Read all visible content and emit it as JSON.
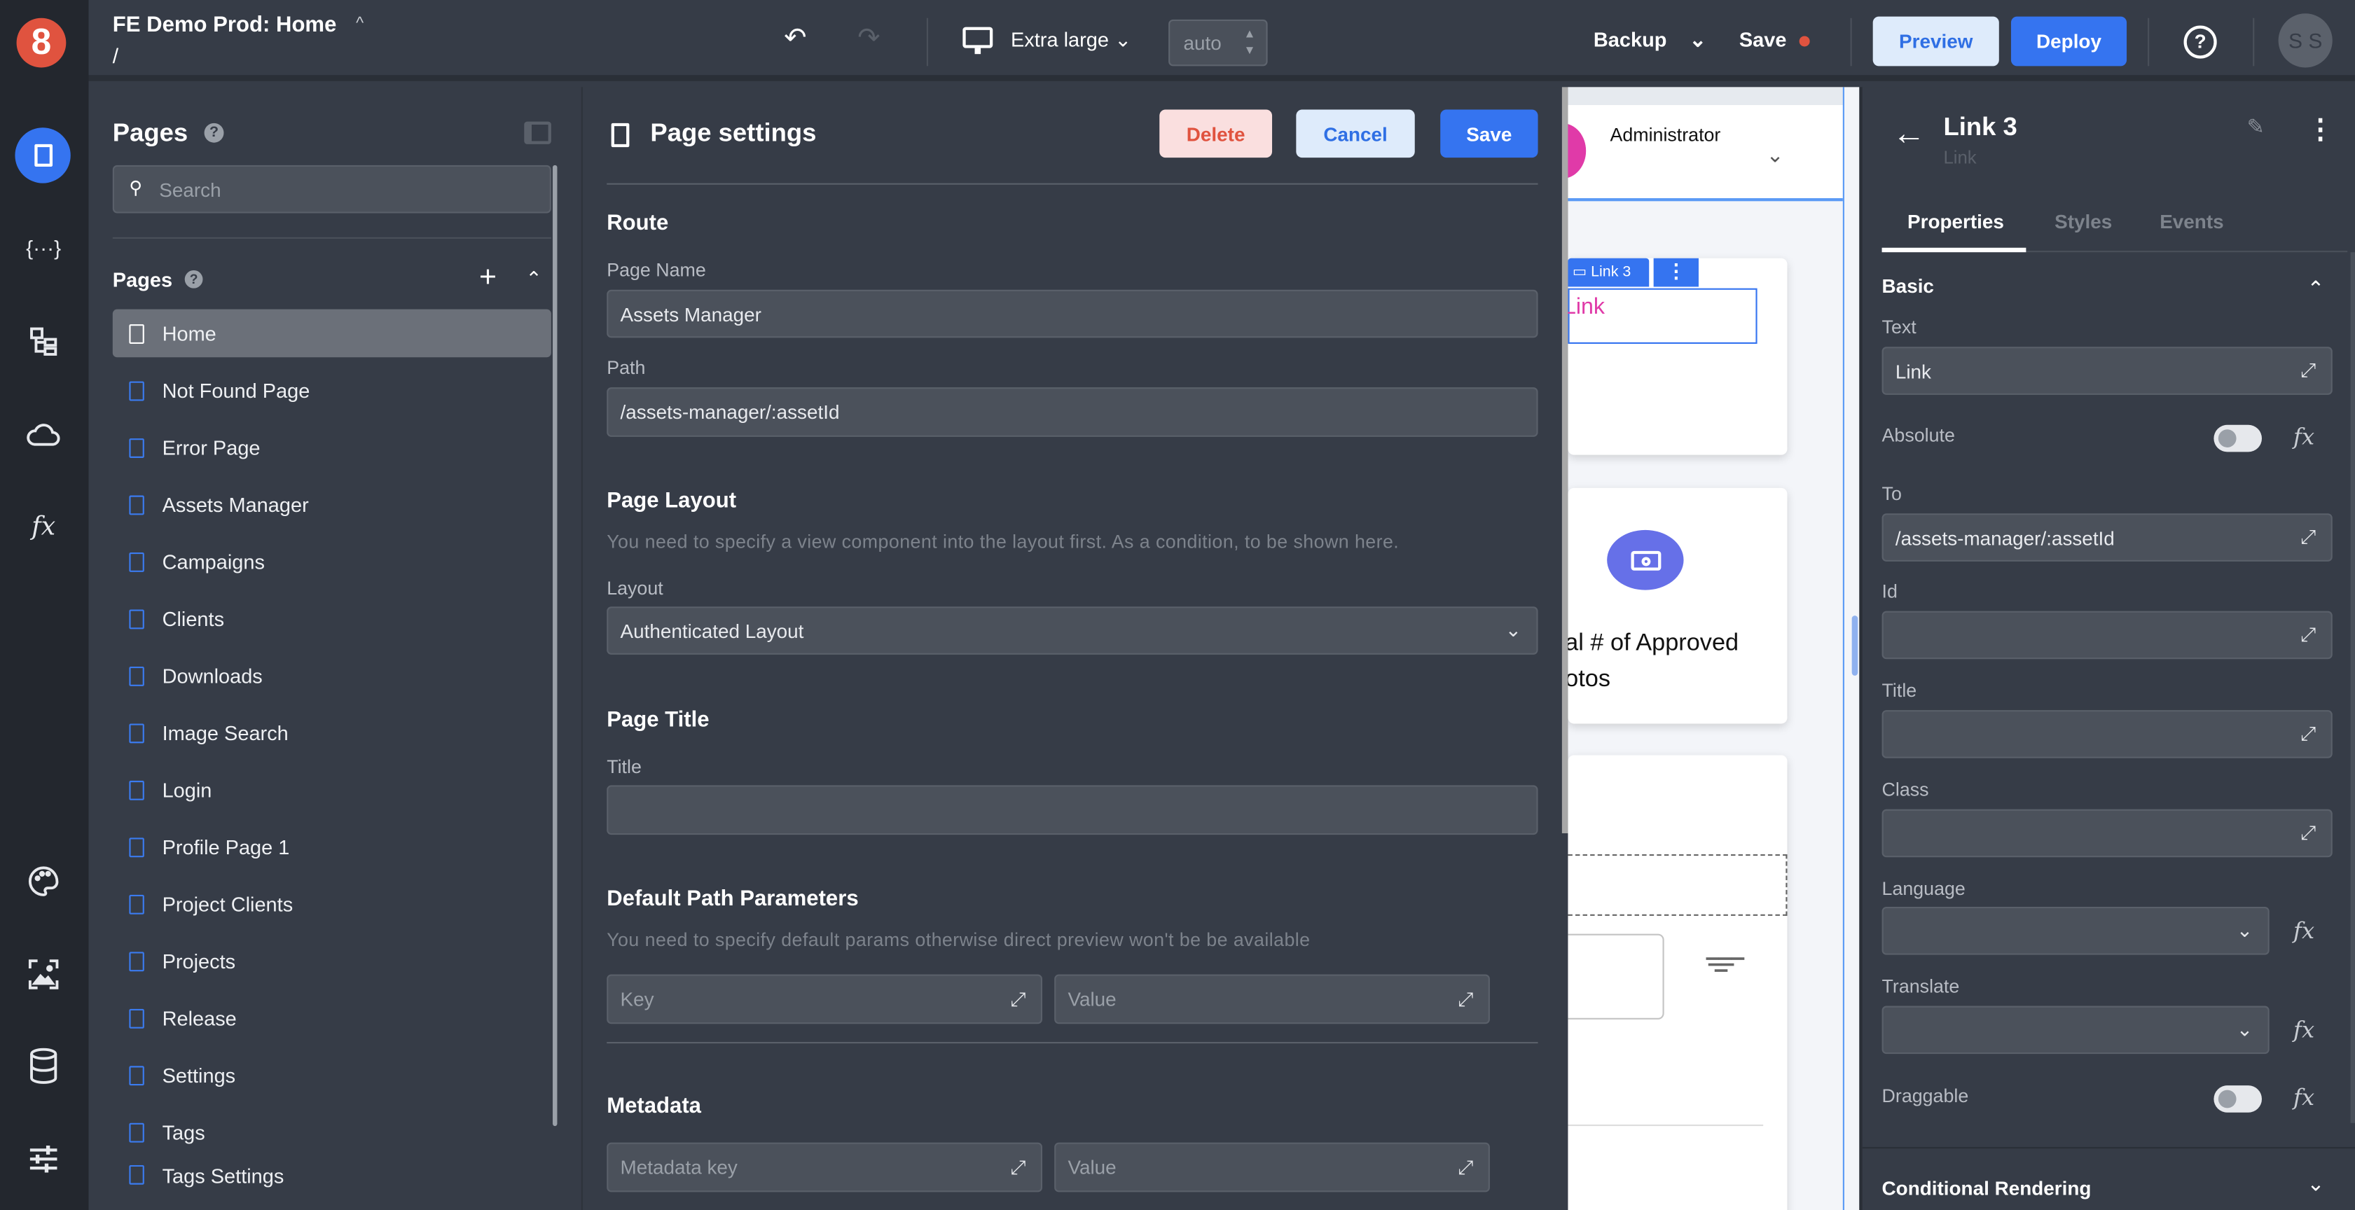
{
  "rail": {
    "logo": "8",
    "top_icons": [
      "pages-icon",
      "variables-icon",
      "components-tree-icon",
      "cloud-icon",
      "functions-icon"
    ],
    "bottom_icons": [
      "palette-icon",
      "media-icon",
      "database-icon",
      "settings-sliders-icon"
    ]
  },
  "topbar": {
    "title": "FE Demo Prod: Home",
    "route": "/",
    "device": "Extra large",
    "zoom": "auto",
    "backup": "Backup",
    "save": "Save",
    "preview": "Preview",
    "deploy": "Deploy",
    "avatar": "S S"
  },
  "pages_panel": {
    "title": "Pages",
    "search_placeholder": "Search",
    "section": "Pages",
    "items": [
      "Home",
      "Not Found Page",
      "Error Page",
      "Assets Manager",
      "Campaigns",
      "Clients",
      "Downloads",
      "Image Search",
      "Login",
      "Profile Page 1",
      "Project Clients",
      "Projects",
      "Release",
      "Settings",
      "Tags",
      "Tags Settings"
    ],
    "selected": "Home"
  },
  "page_settings": {
    "title": "Page settings",
    "delete": "Delete",
    "cancel": "Cancel",
    "save": "Save",
    "route": {
      "heading": "Route",
      "page_name_label": "Page Name",
      "page_name": "Assets Manager",
      "path_label": "Path",
      "path": "/assets-manager/:assetId"
    },
    "layout": {
      "heading": "Page Layout",
      "hint": "You need to specify a view component into the layout first. As a condition, to be shown here.",
      "label": "Layout",
      "value": "Authenticated Layout"
    },
    "page_title": {
      "heading": "Page Title",
      "label": "Title",
      "value": ""
    },
    "params": {
      "heading": "Default Path Parameters",
      "hint": "You need to specify default params otherwise direct preview won't be be available",
      "key_placeholder": "Key",
      "value_placeholder": "Value"
    },
    "metadata": {
      "heading": "Metadata",
      "key_placeholder": "Metadata key",
      "value_placeholder": "Value"
    }
  },
  "canvas": {
    "user": "Administrator",
    "badge": "Link 3",
    "link_text": "Link",
    "stat_line1": "al # of Approved",
    "stat_line2": "otos"
  },
  "inspector": {
    "title": "Link 3",
    "subtitle": "Link",
    "tabs": [
      "Properties",
      "Styles",
      "Events"
    ],
    "active_tab": "Properties",
    "section": "Basic",
    "text_label": "Text",
    "text": "Link",
    "absolute_label": "Absolute",
    "absolute": false,
    "to_label": "To",
    "to": "/assets-manager/:assetId",
    "id_label": "Id",
    "title_label": "Title",
    "class_label": "Class",
    "language_label": "Language",
    "translate_label": "Translate",
    "draggable_label": "Draggable",
    "draggable": false,
    "conditional": "Conditional Rendering"
  },
  "colors": {
    "accent": "#3574f0",
    "logo": "#e0533f",
    "link": "#e03aa8",
    "camera": "#6670e8"
  }
}
